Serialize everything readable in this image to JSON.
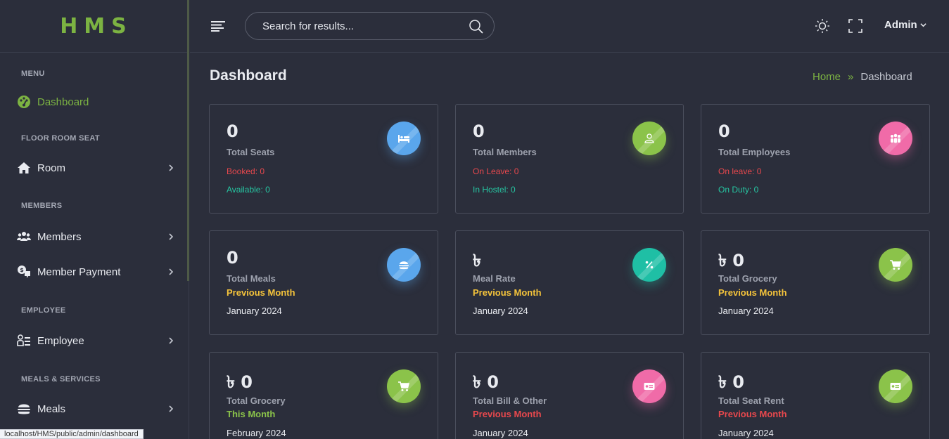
{
  "logo": "HMS",
  "sidebar": {
    "sections": {
      "menu": "MENU",
      "floor": "FLOOR ROOM SEAT",
      "members": "MEMBERS",
      "employee": "EMPLOYEE",
      "meals": "MEALS & SERVICES"
    },
    "items": {
      "dashboard": "Dashboard",
      "room": "Room",
      "members": "Members",
      "member_payment": "Member Payment",
      "employee": "Employee",
      "meals": "Meals"
    }
  },
  "header": {
    "search_placeholder": "Search for results...",
    "admin": "Admin"
  },
  "page": {
    "title": "Dashboard",
    "breadcrumb": {
      "home": "Home",
      "sep": "»",
      "current": "Dashboard"
    }
  },
  "cards": [
    {
      "value": "0",
      "label": "Total Seats",
      "line1": "Booked: 0",
      "line2": "Available: 0",
      "icon": "bed-icon",
      "color": "#5aa6ec"
    },
    {
      "value": "0",
      "label": "Total Members",
      "line1": "On Leave: 0",
      "line2": "In Hostel: 0",
      "icon": "user-icon",
      "color": "#8bc34a"
    },
    {
      "value": "0",
      "label": "Total Employees",
      "line1": "On leave: 0",
      "line2": "On Duty: 0",
      "icon": "group-icon",
      "color": "#f06ba8"
    },
    {
      "value": "0",
      "label": "Total Meals",
      "period": "Previous Month",
      "date": "January 2024",
      "icon": "burger-icon",
      "color": "#5aa6ec"
    },
    {
      "value": "৳",
      "label": "Meal Rate",
      "period": "Previous Month",
      "date": "January 2024",
      "icon": "percent-icon",
      "color": "#1fbfa5"
    },
    {
      "value": "৳ 0",
      "label": "Total Grocery",
      "period": "Previous Month",
      "date": "January 2024",
      "icon": "cart-icon",
      "color": "#8bc34a"
    },
    {
      "value": "৳ 0",
      "label": "Total Grocery",
      "period": "This Month",
      "date": "February 2024",
      "icon": "cart-icon",
      "color": "#8bc34a"
    },
    {
      "value": "৳ 0",
      "label": "Total Bill & Other",
      "period": "Previous Month",
      "date": "January 2024",
      "icon": "money-icon",
      "color": "#f06ba8"
    },
    {
      "value": "৳ 0",
      "label": "Total Seat Rent",
      "period": "Previous Month",
      "date": "January 2024",
      "icon": "money-icon",
      "color": "#8bc34a"
    }
  ],
  "status_url": "localhost/HMS/public/admin/dashboard"
}
